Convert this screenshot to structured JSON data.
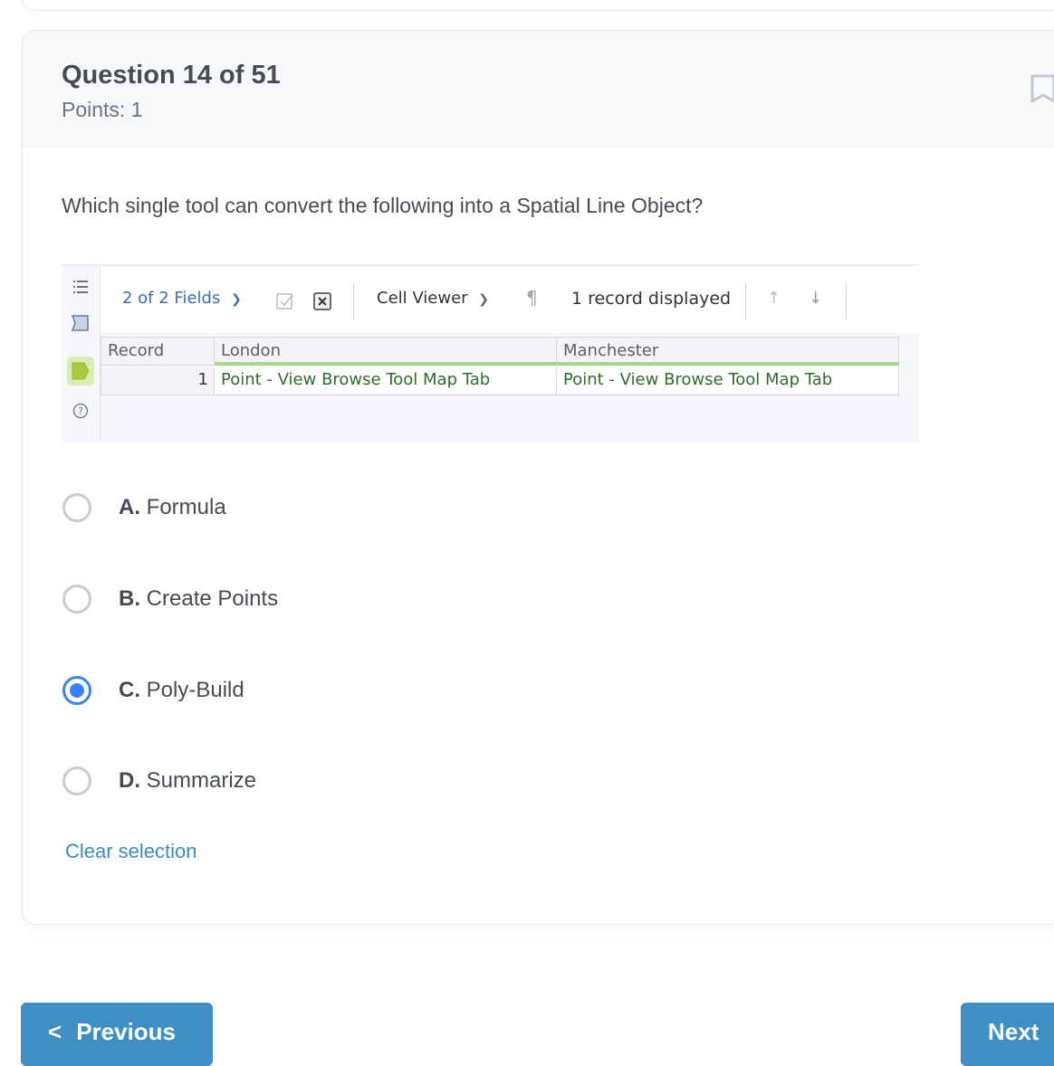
{
  "question": {
    "title": "Question 14 of 51",
    "points": "Points: 1",
    "text": "Which single tool can convert the following into a Spatial Line Object?",
    "bookmark_icon": "bookmark-icon"
  },
  "embedded_screenshot": {
    "toolbar": {
      "fields_label": "2 of 2 Fields",
      "viewer_label": "Cell Viewer",
      "records_label": "1 record displayed"
    },
    "side_icons": [
      "list-icon",
      "input-anchor-icon",
      "output-anchor-icon",
      "help-icon"
    ],
    "grid": {
      "headers": [
        "Record",
        "London",
        "Manchester"
      ],
      "rows": [
        [
          "1",
          "Point - View Browse Tool Map Tab",
          "Point - View Browse Tool Map Tab"
        ]
      ]
    }
  },
  "options": [
    {
      "letter": "A.",
      "label": "Formula",
      "selected": false
    },
    {
      "letter": "B.",
      "label": "Create Points",
      "selected": false
    },
    {
      "letter": "C.",
      "label": "Poly-Build",
      "selected": true
    },
    {
      "letter": "D.",
      "label": "Summarize",
      "selected": false
    }
  ],
  "clear_selection": "Clear selection",
  "nav": {
    "previous": "Previous",
    "next": "Next"
  },
  "colors": {
    "accent": "#3f8fc6",
    "radio_selected": "#3b82f6",
    "link": "#3d8cc4"
  }
}
